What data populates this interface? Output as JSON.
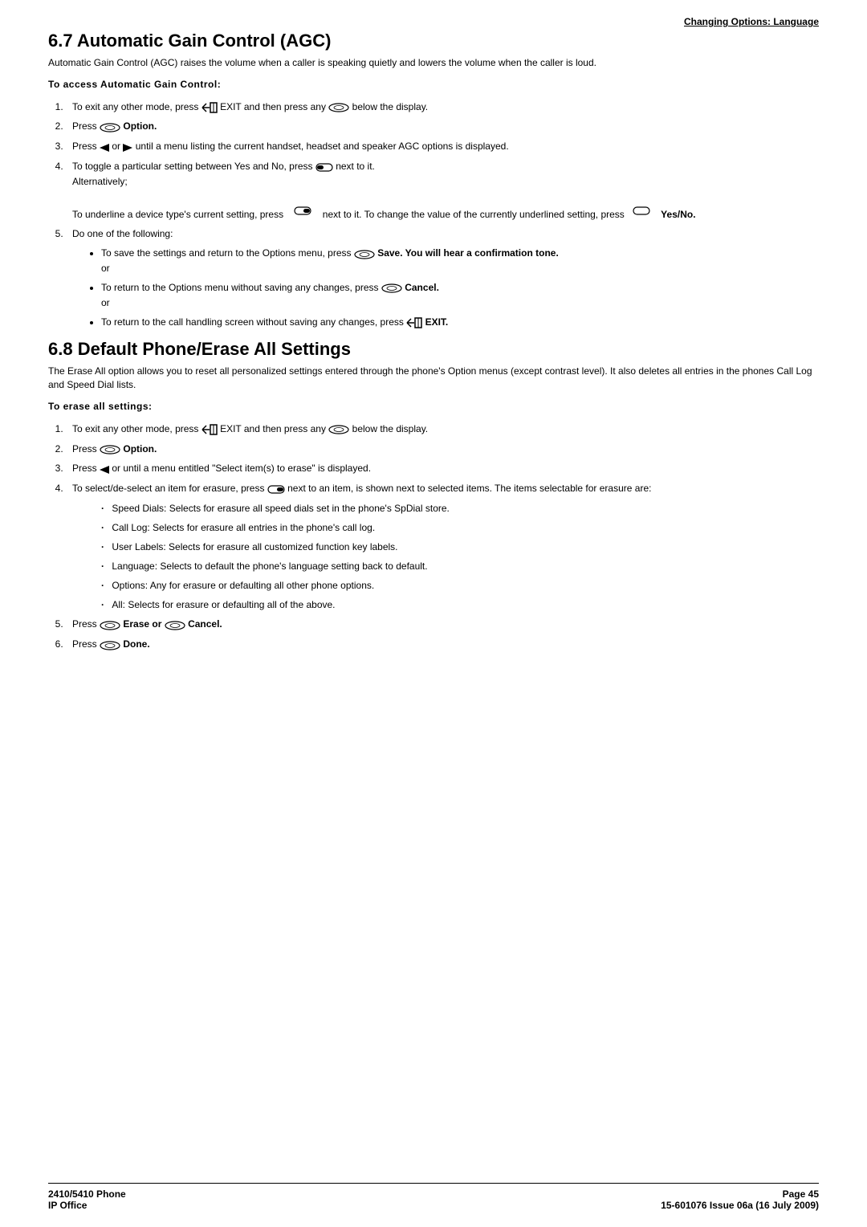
{
  "breadcrumb": "Changing Options: Language",
  "section1": {
    "heading": "6.7 Automatic Gain Control (AGC)",
    "intro": "Automatic Gain Control (AGC) raises the volume when a caller is speaking quietly and lowers the volume when the caller is loud.",
    "lead": "To access Automatic Gain Control:",
    "steps": {
      "s1a": "To exit any other mode, press ",
      "s1b": " EXIT and then press any ",
      "s1c": " below the display.",
      "s2a": "Press ",
      "s2b": " Option.",
      "s3a": "Press ",
      "s3b": " or ",
      "s3c": " until a menu listing the current handset, headset and speaker AGC options is displayed.",
      "s4a": "To toggle a particular setting between Yes and No, press ",
      "s4b": " next to it.",
      "s4c": "Alternatively;",
      "s4d": "To underline a device type's current setting, press",
      "s4e": "next to it. To change the value of the currently underlined setting, press",
      "s4f": "Yes/No.",
      "s5": "Do one of the following:",
      "s5ba": "To save the settings and return to the Options menu, press ",
      "s5bb": " Save. You will hear a confirmation tone.",
      "s5bc": "or",
      "s5ca": "To return to the Options menu without saving any changes, press ",
      "s5cb": " Cancel.",
      "s5cc": "or",
      "s5da": "To return to the call handling screen without saving any changes, press ",
      "s5db": " EXIT."
    }
  },
  "section2": {
    "heading": "6.8 Default Phone/Erase All Settings",
    "intro": "The Erase All option allows you to reset all personalized settings entered through the phone's Option menus (except contrast level). It also deletes all entries in the phones Call Log and Speed Dial lists.",
    "lead": "To erase all settings:",
    "steps": {
      "s1a": "To exit any other mode, press ",
      "s1b": " EXIT and then press any ",
      "s1c": " below the display.",
      "s2a": "Press ",
      "s2b": " Option.",
      "s3a": "Press ",
      "s3b": " or      until a menu entitled \"Select item(s) to erase\" is displayed.",
      "s4a": "To select/de-select an item for erasure, press ",
      "s4b": " next to an item,   is shown next to selected items. The items selectable for erasure are:",
      "items": {
        "i1": "Speed Dials: Selects for erasure all speed dials set in the phone's SpDial store.",
        "i2": "Call Log: Selects for erasure all entries in the phone's call log.",
        "i3": "User Labels: Selects for erasure all customized function key labels.",
        "i4": "Language: Selects to default the phone's language setting back to default.",
        "i5": "Options: Any for erasure or defaulting all other phone options.",
        "i6": "All: Selects for erasure or defaulting all of the above."
      },
      "s5a": "Press ",
      "s5b": " Erase or ",
      "s5c": " Cancel.",
      "s6a": "Press ",
      "s6b": " Done."
    }
  },
  "footer": {
    "left1": "2410/5410 Phone",
    "left2": "IP Office",
    "right1": "Page 45",
    "right2": "15-601076 Issue 06a (16 July 2009)"
  }
}
